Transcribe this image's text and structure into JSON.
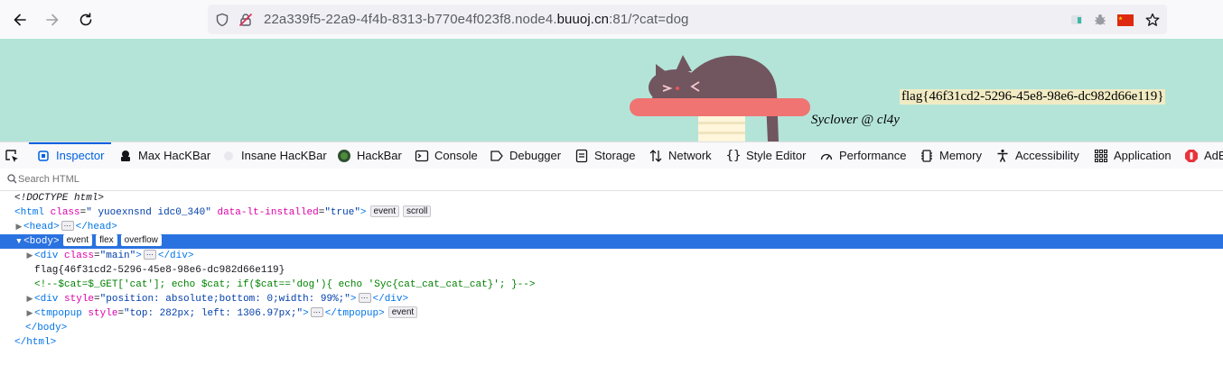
{
  "browser": {
    "url_prefix": "22a339f5-22a9-4f4b-8313-b770e4f023f8.node4.",
    "url_host": "buuoj.cn",
    "url_suffix": ":81/?cat=dog",
    "accent_color": "#0061e0"
  },
  "page": {
    "flag": "flag{46f31cd2-5296-45e8-98e6-dc982d66e119}",
    "credit": "Syclover @ cl4y",
    "background": "#b4e4d8"
  },
  "devtools": {
    "tabs": [
      {
        "label": "Inspector",
        "icon": "inspector-icon"
      },
      {
        "label": "Max HacKBar",
        "icon": "max-hackbar-icon"
      },
      {
        "label": "Insane HacKBar",
        "icon": "insane-hackbar-icon"
      },
      {
        "label": "HackBar",
        "icon": "hackbar-icon"
      },
      {
        "label": "Console",
        "icon": "console-icon"
      },
      {
        "label": "Debugger",
        "icon": "debugger-icon"
      },
      {
        "label": "Storage",
        "icon": "storage-icon"
      },
      {
        "label": "Network",
        "icon": "network-icon"
      },
      {
        "label": "Style Editor",
        "icon": "style-editor-icon"
      },
      {
        "label": "Performance",
        "icon": "performance-icon"
      },
      {
        "label": "Memory",
        "icon": "memory-icon"
      },
      {
        "label": "Accessibility",
        "icon": "accessibility-icon"
      },
      {
        "label": "Application",
        "icon": "application-icon"
      },
      {
        "label": "AdB",
        "icon": "adblock-icon"
      }
    ],
    "search_placeholder": "Search HTML"
  },
  "tree": {
    "doctype": "<!DOCTYPE html>",
    "html_open": "<html",
    "html_class_attr": "class",
    "html_class_val": "\" yuoexnsnd idc0_340\"",
    "html_lt_attr": "data-lt-installed",
    "html_lt_val": "\"true\"",
    "html_close_bracket": ">",
    "badge_event": "event",
    "badge_scroll": "scroll",
    "badge_flex": "flex",
    "badge_overflow": "overflow",
    "head_open": "<head>",
    "head_close": "</head>",
    "body_open": "<body>",
    "div_main_open": "<div",
    "div_main_attr": "class",
    "div_main_val": "\"main\"",
    "gt": ">",
    "div_close": "</div>",
    "flag_text": "flag{46f31cd2-5296-45e8-98e6-dc982d66e119}",
    "comment": "<!--$cat=$_GET['cat']; echo $cat; if($cat=='dog'){ echo 'Syc{cat_cat_cat_cat}'; }-->",
    "div_style_attr": "style",
    "div_style_val": "\"position: absolute;bottom: 0;width: 99%;\"",
    "tmp_open": "<tmpopup",
    "tmp_style_val": "\"top: 282px; left: 1306.97px;\"",
    "tmp_close": "</tmpopup>",
    "body_close": "</body>",
    "html_close": "</html>",
    "ellipsis": "⋯"
  }
}
